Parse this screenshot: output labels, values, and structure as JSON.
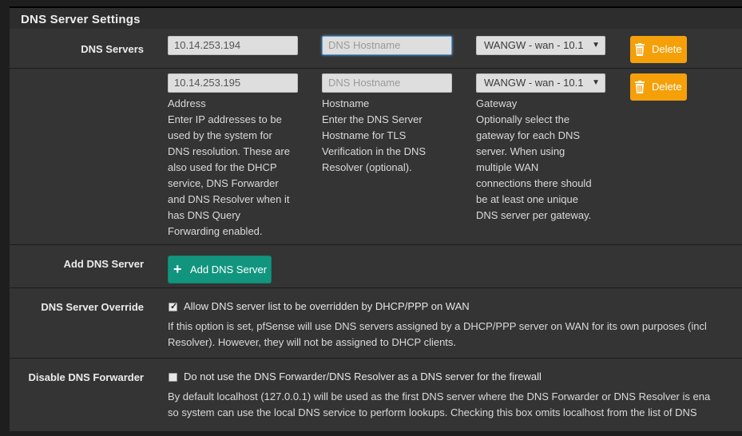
{
  "panel": {
    "title": "DNS Server Settings"
  },
  "dns_servers": {
    "label": "DNS Servers",
    "rows": [
      {
        "address": "10.14.253.194",
        "hostname": "",
        "hostname_placeholder": "DNS Hostname",
        "gateway": "WANGW - wan - 10.1",
        "delete_label": "Delete"
      },
      {
        "address": "10.14.253.195",
        "hostname": "",
        "hostname_placeholder": "DNS Hostname",
        "gateway": "WANGW - wan - 10.1",
        "delete_label": "Delete"
      }
    ],
    "help": {
      "address": {
        "title": "Address",
        "lines": [
          "Enter IP addresses to be",
          "used by the system for",
          "DNS resolution. These are",
          "also used for the DHCP",
          "service, DNS Forwarder",
          "and DNS Resolver when it",
          "has DNS Query",
          "Forwarding enabled."
        ]
      },
      "hostname": {
        "title": "Hostname",
        "lines": [
          "Enter the DNS Server",
          "Hostname for TLS",
          "Verification in the DNS",
          "Resolver (optional)."
        ]
      },
      "gateway": {
        "title": "Gateway",
        "lines": [
          "Optionally select the",
          "gateway for each DNS",
          "server. When using",
          "multiple WAN",
          "connections there should",
          "be at least one unique",
          "DNS server per gateway."
        ]
      }
    }
  },
  "add_dns_server": {
    "label": "Add DNS Server",
    "button_label": "Add DNS Server"
  },
  "dns_override": {
    "label": "DNS Server Override",
    "checked": true,
    "checkbox_label": "Allow DNS server list to be overridden by DHCP/PPP on WAN",
    "description_lines": [
      "If this option is set, pfSense will use DNS servers assigned by a DHCP/PPP server on WAN for its own purposes (incl",
      "Resolver). However, they will not be assigned to DHCP clients."
    ]
  },
  "disable_forwarder": {
    "label": "Disable DNS Forwarder",
    "checked": false,
    "checkbox_label": "Do not use the DNS Forwarder/DNS Resolver as a DNS server for the firewall",
    "description_lines": [
      "By default localhost (127.0.0.1) will be used as the first DNS server where the DNS Forwarder or DNS Resolver is ena",
      "so system can use the local DNS service to perform lookups. Checking this box omits localhost from the list of DNS"
    ]
  },
  "colors": {
    "delete_button": "#f5a008",
    "add_button": "#12957f",
    "panel_bg": "#343434",
    "page_bg": "#1e1e1e"
  },
  "icons": {
    "delete": "trash-icon",
    "add": "plus-icon",
    "select": "caret-down-icon",
    "checkbox": "check-icon"
  }
}
